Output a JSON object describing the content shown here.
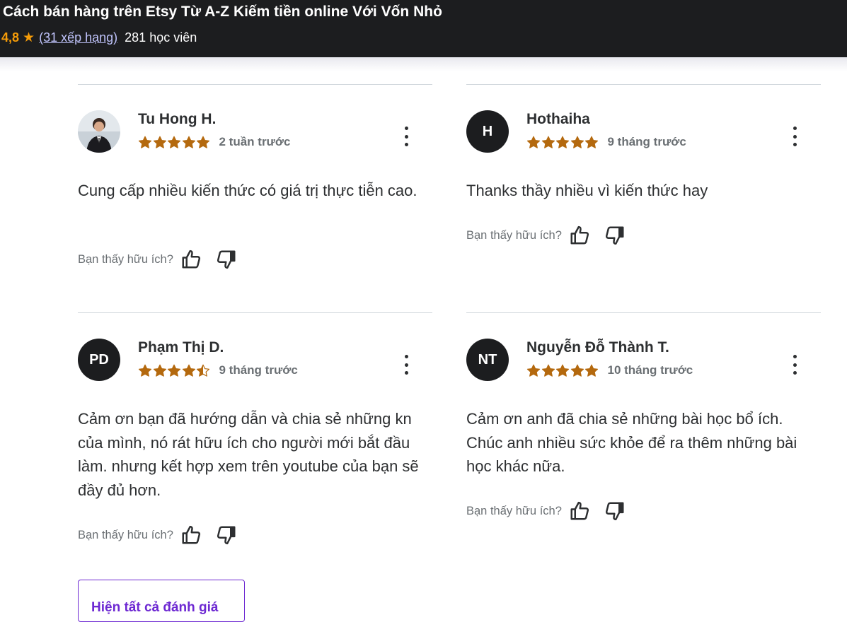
{
  "course": {
    "title": "Cách bán hàng trên Etsy Từ A-Z Kiếm tiền online Với Vốn Nhỏ",
    "rating": "4,8",
    "ratings_link": "(31 xếp hạng)",
    "students": "281 học viên"
  },
  "colors": {
    "star": "#b4690e",
    "accent": "#6d28d2",
    "header_bg": "#1c1d1f"
  },
  "helpful_label": "Bạn thấy hữu ích?",
  "reviews": [
    {
      "name": "Tu Hong H.",
      "initials": "",
      "avatar": "photo",
      "rating": 5,
      "time": "2 tuần trước",
      "content": "Cung cấp nhiều kiến thức có giá trị thực tiễn cao."
    },
    {
      "name": "Hothaiha",
      "initials": "H",
      "rating": 5,
      "time": "9 tháng trước",
      "content": "Thanks thầy nhiều vì kiến thức hay"
    },
    {
      "name": "Phạm Thị D.",
      "initials": "PD",
      "rating": 4.5,
      "time": "9 tháng trước",
      "content": "Cảm ơn bạn đã hướng dẫn và chia sẻ những kn của mình, nó rát hữu ích cho người mới bắt đầu làm. nhưng kết hợp xem trên youtube của bạn sẽ đầy đủ hơn."
    },
    {
      "name": "Nguyễn Đỗ Thành T.",
      "initials": "NT",
      "rating": 5,
      "time": "10 tháng trước",
      "content": "Cảm ơn anh đã chia sẻ những bài học bổ ích. Chúc anh nhiều sức khỏe để ra thêm những bài học khác nữa."
    }
  ],
  "show_all_button": "Hiện tất cả đánh giá"
}
